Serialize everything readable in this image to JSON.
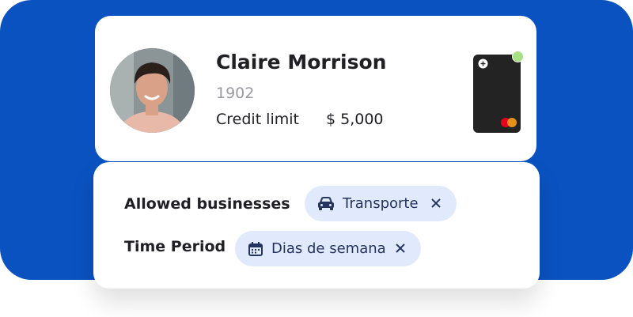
{
  "profile": {
    "name": "Claire Morrison",
    "id": "1902",
    "credit_label": "Credit limit",
    "credit_value": "$ 5,000"
  },
  "card": {
    "status": "active",
    "network_icon": "mastercard-icon",
    "status_color": "#a7df84"
  },
  "restrictions": {
    "businesses_label": "Allowed businesses",
    "businesses_chip": "Transporte",
    "period_label": "Time Period",
    "period_chip": "Dias de semana"
  },
  "colors": {
    "background_blue": "#0a52c0",
    "chip_bg": "#e1eafd",
    "chip_text": "#24335f"
  }
}
